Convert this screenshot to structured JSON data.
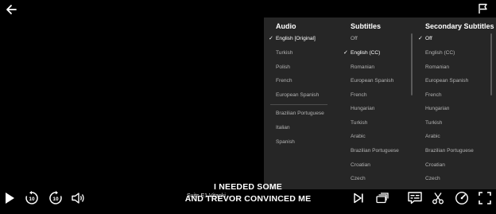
{
  "audio": {
    "header": "Audio",
    "items": [
      "English [Original]",
      "Turkish",
      "Polish",
      "French",
      "European Spanish",
      "Brazilian Portuguese",
      "Italian",
      "Spanish"
    ],
    "selected": 0
  },
  "subtitles": {
    "header": "Subtitles",
    "items": [
      "Off",
      "English (CC)",
      "Romanian",
      "European Spanish",
      "French",
      "Hungarian",
      "Turkish",
      "Arabic",
      "Brazilian Portuguese",
      "Croatian",
      "Czech"
    ],
    "selected": 1
  },
  "secondary_subtitles": {
    "header": "Secondary Subtitles",
    "items": [
      "Off",
      "English (CC)",
      "Romanian",
      "European Spanish",
      "French",
      "Hungarian",
      "Turkish",
      "Arabic",
      "Brazilian Portuguese",
      "Croatian",
      "Czech"
    ],
    "selected": 0
  },
  "captions": {
    "line1": "I NEEDED SOME",
    "line2": "AND TREVOR CONVINCED ME"
  },
  "episode_title": "Suits E1  Vitanki ...",
  "controls": {
    "rewind_seconds": "10",
    "forward_seconds": "10"
  }
}
